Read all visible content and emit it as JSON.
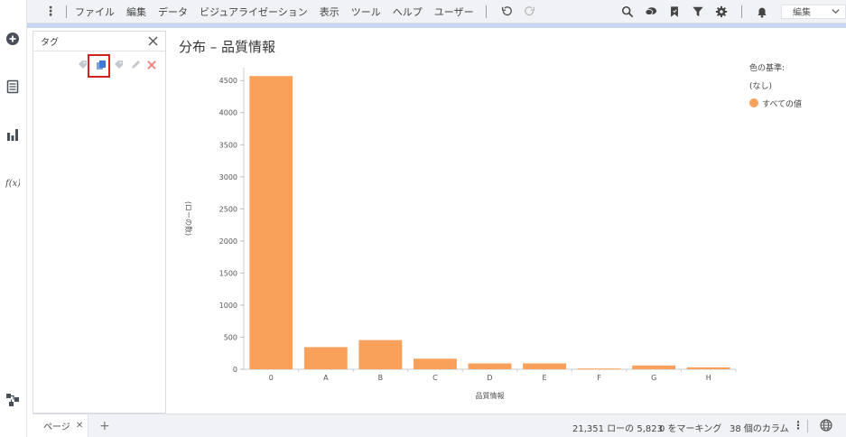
{
  "toolbar": {
    "menu": [
      "ファイル",
      "編集",
      "データ",
      "ビジュアライゼーション",
      "表示",
      "ツール",
      "ヘルプ",
      "ユーザー"
    ],
    "mode_select": "編集",
    "icons": [
      "search-icon",
      "comment-icon",
      "bookmark-icon",
      "filter-icon",
      "settings-icon",
      "notification-icon"
    ]
  },
  "left_rail": {
    "icons": [
      "add-icon",
      "data-table-icon",
      "bar-chart-icon",
      "function-icon",
      "data-canvas-icon"
    ]
  },
  "tag_panel": {
    "title": "タグ",
    "tools": [
      "new-tag-icon",
      "copy-tag-icon",
      "tag-icon",
      "edit-icon",
      "delete-icon"
    ]
  },
  "visualization": {
    "title": "分布 – 品質情報"
  },
  "legend": {
    "title": "色の基準:",
    "subtitle": "(なし)",
    "item": "すべての値",
    "color": "#f9a05b"
  },
  "chart_data": {
    "type": "bar",
    "categories": [
      "0",
      "A",
      "B",
      "C",
      "D",
      "E",
      "F",
      "G",
      "H"
    ],
    "values": [
      4570,
      345,
      455,
      165,
      92,
      92,
      12,
      60,
      30
    ],
    "xlabel": "品質情報",
    "ylabel": "(ローの数)",
    "ylim": [
      0,
      4700
    ],
    "yticks": [
      0,
      500,
      1000,
      1500,
      2000,
      2500,
      3000,
      3500,
      4000,
      4500
    ],
    "bar_color": "#f9a05b"
  },
  "status_bar": {
    "page_tab": "ページ",
    "rows": "21,351 ローの 5,823",
    "marking": "0 をマーキング",
    "columns": "38 個のカラム"
  }
}
